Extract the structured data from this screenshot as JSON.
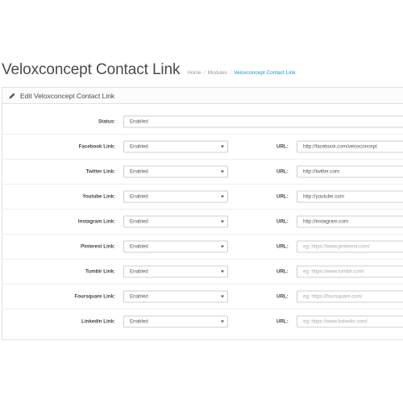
{
  "header": {
    "title": "Veloxconcept Contact Link",
    "breadcrumb": [
      "Home",
      "Modules",
      "Veloxconcept Contact Link"
    ]
  },
  "panel": {
    "heading": "Edit Veloxconcept Contact Link",
    "status": {
      "label": "Status:",
      "value": "Enabled"
    },
    "url_label": "URL:",
    "links": [
      {
        "label": "Facebook Link:",
        "value": "Enabled",
        "url": "http://facebook.com/veloxconcept",
        "placeholder": ""
      },
      {
        "label": "Twitter Link:",
        "value": "Enabled",
        "url": "http://twitter.com",
        "placeholder": ""
      },
      {
        "label": "Youtube Link:",
        "value": "Enabled",
        "url": "http://youtube.com",
        "placeholder": ""
      },
      {
        "label": "Instagram Link:",
        "value": "Enabled",
        "url": "http://instagram.com",
        "placeholder": ""
      },
      {
        "label": "Pinterest Link:",
        "value": "Enabled",
        "url": "",
        "placeholder": "eg: https://www.pinterest.com/"
      },
      {
        "label": "Tumblr Link:",
        "value": "Enabled",
        "url": "",
        "placeholder": "eg: https://www.tumblr.com/"
      },
      {
        "label": "Foursquare Link:",
        "value": "Enabled",
        "url": "",
        "placeholder": "eg: https://foursquare.com/"
      },
      {
        "label": "Linkedin Link:",
        "value": "Enabled",
        "url": "",
        "placeholder": "eg: https://www.linkedin.com/"
      }
    ]
  },
  "colors": {
    "accent": "#1e91cf",
    "border": "#e2e2e2",
    "text": "#4a4a4a"
  },
  "icons": {
    "heading": "pencil-icon",
    "select": "caret-down-icon"
  }
}
